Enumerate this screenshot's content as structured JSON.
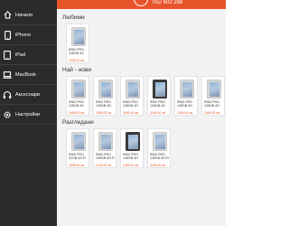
{
  "header": {
    "phone": "052 602 288",
    "accent_color": "#e8542a"
  },
  "sidebar": {
    "items": [
      {
        "label": "Начало",
        "icon": "home-icon"
      },
      {
        "label": "iPhone",
        "icon": "phone-icon"
      },
      {
        "label": "iPad",
        "icon": "tablet-icon"
      },
      {
        "label": "MacBook",
        "icon": "laptop-icon"
      },
      {
        "label": "Аксесоари",
        "icon": "headphones-icon"
      },
      {
        "label": "Настройки",
        "icon": "gear-icon"
      }
    ]
  },
  "sections": [
    {
      "title": "Любими",
      "products": [
        {
          "name": "IPAD PRO 128GB 4G",
          "price": "2499.00 лв."
        }
      ]
    },
    {
      "title": "Най - нови",
      "products": [
        {
          "name": "IPAD PRO 128GB 4G",
          "price": "2499.00 лв."
        },
        {
          "name": "IPAD PRO 128GB 4G",
          "price": "2499.00 лв."
        },
        {
          "name": "IPAD PRO 128GB 4G",
          "price": "2499.00 лв."
        },
        {
          "name": "IPAD PRO 128GB 4G",
          "price": "2199.00 лв."
        },
        {
          "name": "IPAD PRO 128GB 4G",
          "price": "2499.00 лв."
        },
        {
          "name": "IPAD PRO 128GB 4G",
          "price": "2499.00 лв."
        }
      ]
    },
    {
      "title": "Разгледани",
      "products": [
        {
          "name": "IPAD PRO 32GB WI-FI",
          "price": "1899.00 лв."
        },
        {
          "name": "IPAD PRO 128GB WI-FI",
          "price": "2199.00 лв."
        },
        {
          "name": "IPAD PRO 128GB 4G",
          "price": "2499.00 лв."
        },
        {
          "name": "IPAD PRO 128GB WI-FI",
          "price": "2199.00 лв."
        }
      ]
    }
  ]
}
